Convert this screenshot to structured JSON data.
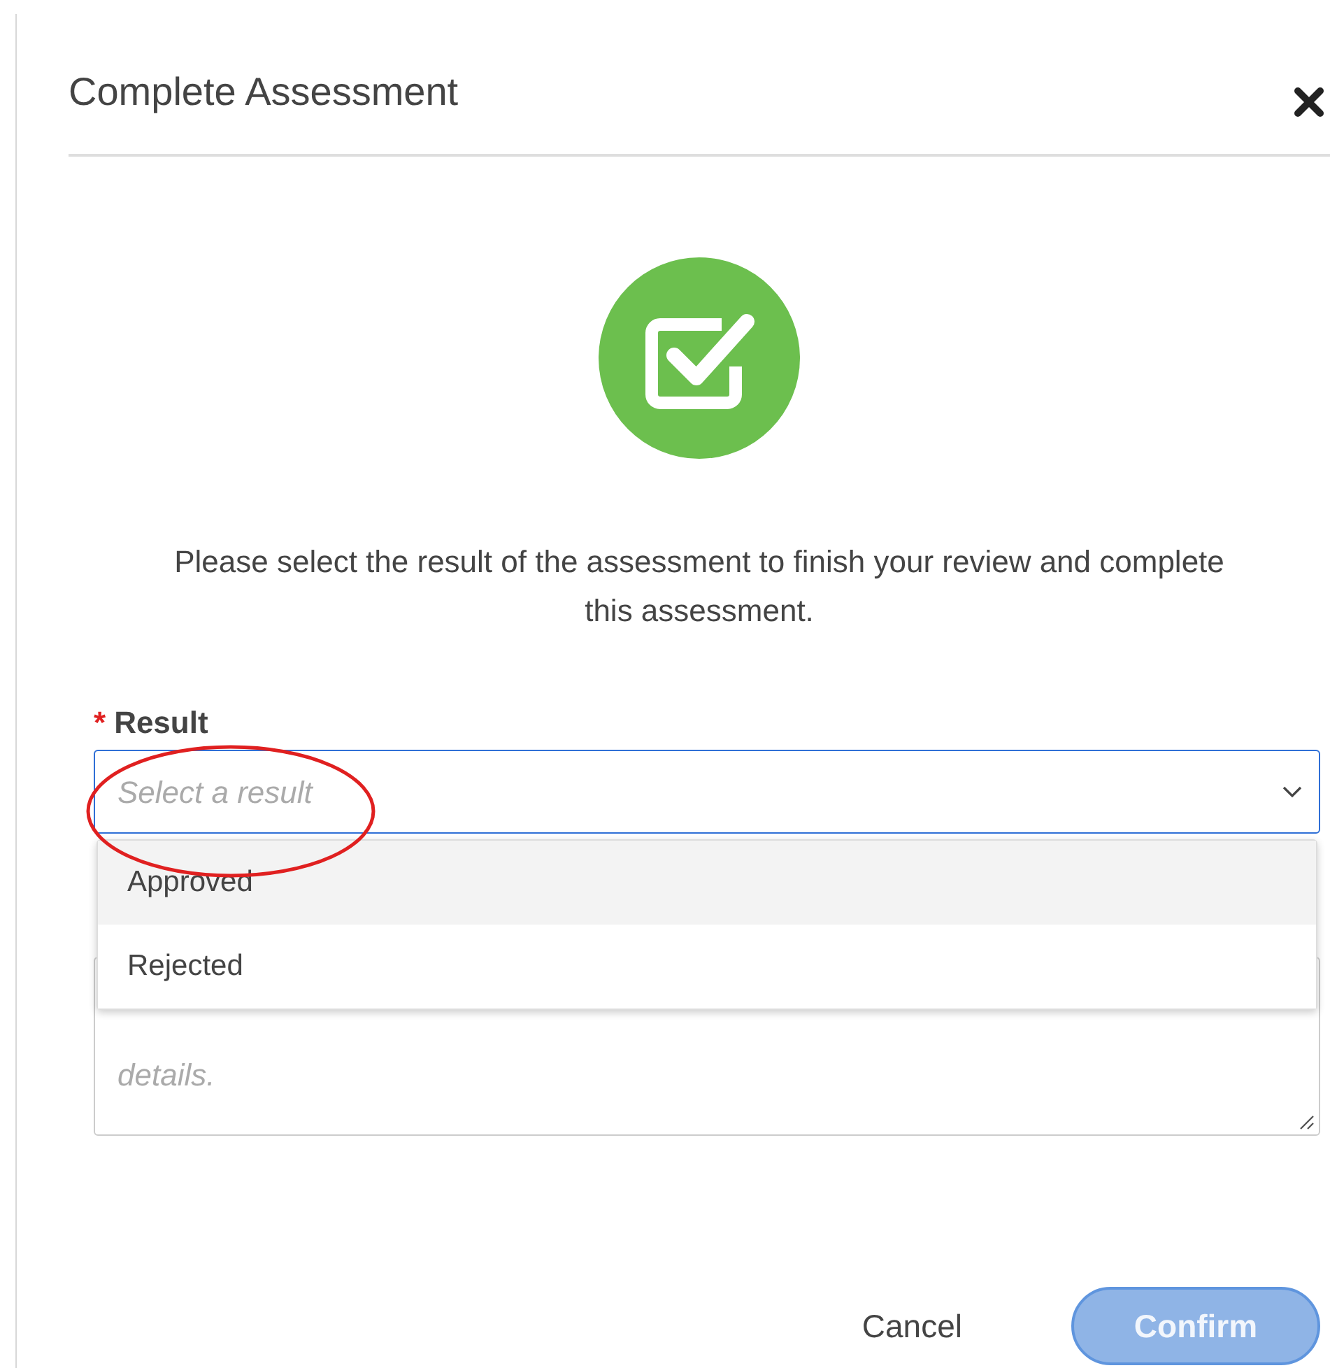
{
  "dialog": {
    "title": "Complete Assessment",
    "message": "Please select the result of the assessment to finish your review and complete this assessment."
  },
  "result_field": {
    "label": "Result",
    "required_mark": "*",
    "placeholder": "Select a result",
    "expanded": true
  },
  "options": [
    {
      "label": "Approved",
      "selected": true
    },
    {
      "label": "Rejected",
      "selected": false
    }
  ],
  "comment_field": {
    "placeholder": "details."
  },
  "annotation": {
    "kind": "ellipse",
    "color": "#e02020"
  },
  "buttons": [
    {
      "label": "Cancel",
      "kind": "link",
      "disabled": false
    },
    {
      "label": "Confirm",
      "kind": "primary",
      "disabled": true
    }
  ]
}
